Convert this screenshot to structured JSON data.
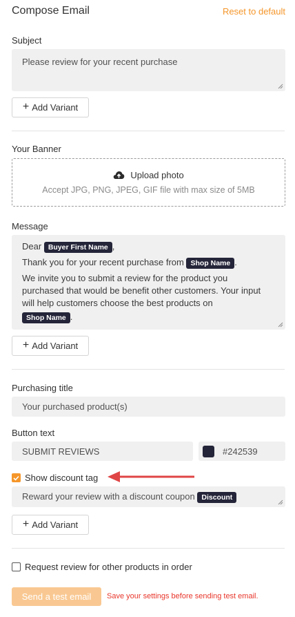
{
  "header": {
    "title": "Compose Email",
    "reset_label": "Reset to default"
  },
  "subject": {
    "label": "Subject",
    "value": "Please review for your recent purchase",
    "add_variant_label": "Add Variant"
  },
  "banner": {
    "label": "Your Banner",
    "upload_label": "Upload photo",
    "hint": "Accept JPG, PNG, JPEG, GIF file with max size of 5MB"
  },
  "message": {
    "label": "Message",
    "greeting_prefix": "Dear",
    "greeting_tag": "Buyer First Name",
    "greeting_suffix": ",",
    "line2_prefix": "Thank you for your recent purchase from",
    "line2_tag": "Shop Name",
    "line2_suffix": ".",
    "para_line1": "We invite you to submit a review for the product you",
    "para_line2": "purchased that would be benefit other customers. Your input",
    "para_line3": "will help customers choose the best products on",
    "para_tag": "Shop Name",
    "para_suffix": ".",
    "add_variant_label": "Add Variant"
  },
  "purchasing_title": {
    "label": "Purchasing title",
    "value": "Your purchased product(s)"
  },
  "button_text": {
    "label": "Button text",
    "value": "SUBMIT REVIEWS",
    "color_hex": "#242539"
  },
  "discount": {
    "checkbox_label": "Show discount tag",
    "checked": true,
    "text": "Reward your review with a discount coupon",
    "tag": "Discount",
    "add_variant_label": "Add Variant"
  },
  "other_products": {
    "checkbox_label": "Request review for other products in order",
    "checked": false
  },
  "footer": {
    "send_label": "Send a test email",
    "warning": "Save your settings before sending test email."
  },
  "colors": {
    "accent": "#f5962a",
    "tag_bg": "#242539",
    "warning": "#e8352a",
    "arrow": "#e04545"
  },
  "icons": {
    "plus": "plus-icon",
    "upload": "cloud-upload-icon",
    "check": "check-icon",
    "resize": "resize-handle-icon",
    "arrow": "arrow-left-icon"
  }
}
